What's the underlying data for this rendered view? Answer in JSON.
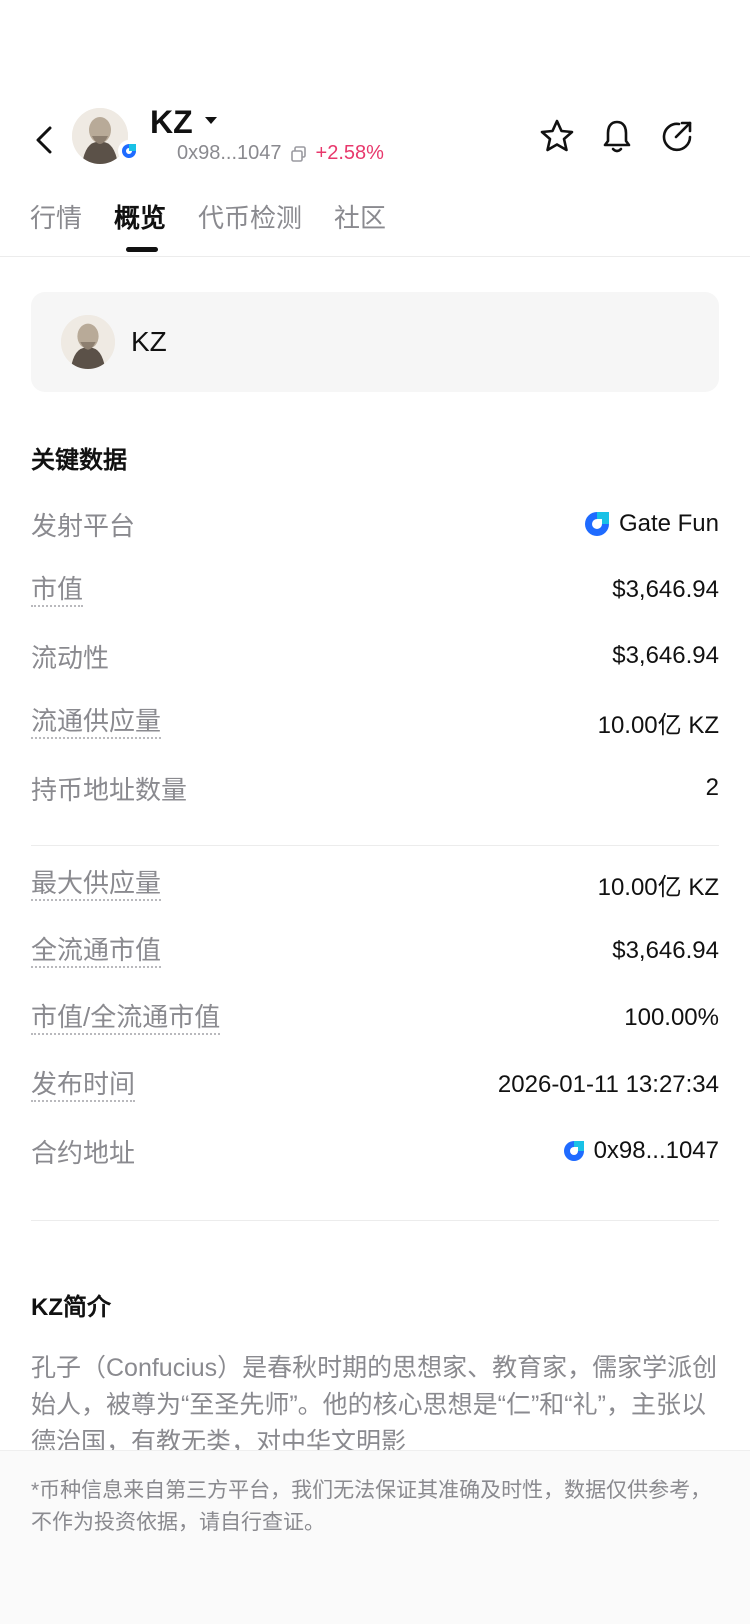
{
  "header": {
    "symbol": "KZ",
    "address_short": "0x98...1047",
    "change": "+2.58%",
    "change_color": "#e8386c",
    "icons": [
      "back-icon",
      "star-icon",
      "bell-icon",
      "share-icon",
      "copy-icon",
      "chevron-down-icon"
    ]
  },
  "tabs": [
    {
      "label": "行情",
      "active": false
    },
    {
      "label": "概览",
      "active": true
    },
    {
      "label": "代币检测",
      "active": false
    },
    {
      "label": "社区",
      "active": false
    }
  ],
  "token_card": {
    "name": "KZ"
  },
  "key_data": {
    "title": "关键数据",
    "rows": [
      {
        "label": "发射平台",
        "value": "Gate Fun"
      },
      {
        "label": "市值",
        "value": "$3,646.94"
      },
      {
        "label": "流动性",
        "value": "$3,646.94"
      },
      {
        "label": "流通供应量",
        "value": "10.00亿 KZ"
      },
      {
        "label": "持币地址数量",
        "value": "2"
      },
      {
        "label": "最大供应量",
        "value": "10.00亿 KZ"
      },
      {
        "label": "全流通市值",
        "value": "$3,646.94"
      },
      {
        "label": "市值/全流通市值",
        "value": "100.00%"
      },
      {
        "label": "发布时间",
        "value": "2026-01-11 13:27:34"
      },
      {
        "label": "合约地址",
        "value": "0x98...1047"
      }
    ]
  },
  "intro": {
    "title": "KZ简介",
    "text": "孔子（Confucius）是春秋时期的思想家、教育家，儒家学派创始人，被尊为“至圣先师”。他的核心思想是“仁”和“礼”，主张以德治国，有教无类，对中华文明影"
  },
  "footer": {
    "disclaimer": "*币种信息来自第三方平台，我们无法保证其准确及时性，数据仅供参考，不作为投资依据，请自行查证。"
  },
  "colors": {
    "brand_blue": "#1f6bff",
    "accent_cyan": "#19c1e6",
    "text_secondary": "#8a8a8f"
  }
}
